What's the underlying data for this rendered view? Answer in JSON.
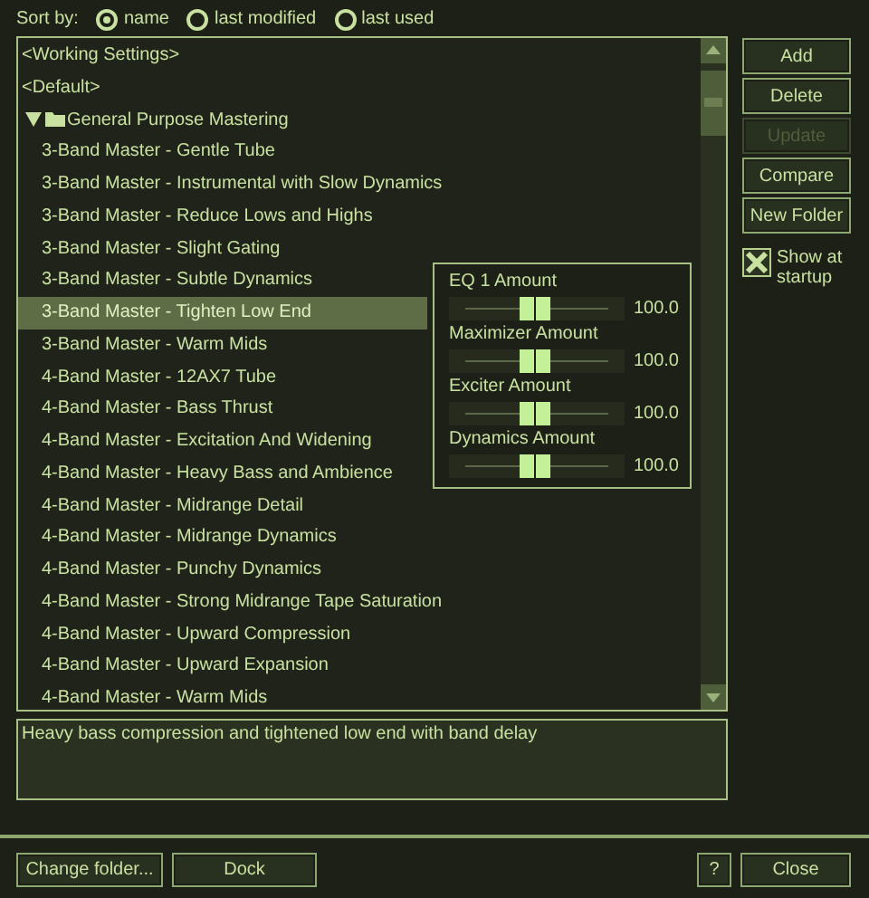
{
  "sort": {
    "label": "Sort by:",
    "options": [
      {
        "label": "name",
        "selected": true
      },
      {
        "label": "last modified",
        "selected": false
      },
      {
        "label": "last used",
        "selected": false
      }
    ]
  },
  "presets": [
    {
      "kind": "item",
      "label": "<Working Settings>",
      "selected": false
    },
    {
      "kind": "item",
      "label": "<Default>",
      "selected": false
    },
    {
      "kind": "folder",
      "label": "General Purpose Mastering",
      "expanded": true,
      "children": [
        {
          "label": "3-Band Master - Gentle Tube",
          "selected": false
        },
        {
          "label": "3-Band Master - Instrumental with Slow Dynamics",
          "selected": false
        },
        {
          "label": "3-Band Master - Reduce Lows and Highs",
          "selected": false
        },
        {
          "label": "3-Band Master - Slight Gating",
          "selected": false
        },
        {
          "label": "3-Band Master - Subtle Dynamics",
          "selected": false
        },
        {
          "label": "3-Band Master - Tighten Low End",
          "selected": true
        },
        {
          "label": "3-Band Master - Warm Mids",
          "selected": false
        },
        {
          "label": "4-Band Master - 12AX7 Tube",
          "selected": false
        },
        {
          "label": "4-Band Master - Bass Thrust",
          "selected": false
        },
        {
          "label": "4-Band Master - Excitation And Widening",
          "selected": false
        },
        {
          "label": "4-Band Master - Heavy Bass and Ambience",
          "selected": false
        },
        {
          "label": "4-Band Master - Midrange Detail",
          "selected": false
        },
        {
          "label": "4-Band Master - Midrange Dynamics",
          "selected": false
        },
        {
          "label": "4-Band Master - Punchy Dynamics",
          "selected": false
        },
        {
          "label": "4-Band Master - Strong Midrange Tape Saturation",
          "selected": false
        },
        {
          "label": "4-Band Master - Upward Compression",
          "selected": false
        },
        {
          "label": "4-Band Master - Upward Expansion",
          "selected": false
        },
        {
          "label": "4-Band Master - Warm Mids",
          "selected": false
        }
      ]
    }
  ],
  "amounts": [
    {
      "label": "EQ 1 Amount",
      "level": 0.5,
      "reading": "100.0"
    },
    {
      "label": "Maximizer Amount",
      "level": 0.5,
      "reading": "100.0"
    },
    {
      "label": "Exciter Amount",
      "level": 0.5,
      "reading": "100.0"
    },
    {
      "label": "Dynamics Amount",
      "level": 0.5,
      "reading": "100.0"
    }
  ],
  "side_buttons": [
    {
      "label": "Add",
      "disabled": false
    },
    {
      "label": "Delete",
      "disabled": false
    },
    {
      "label": "Update",
      "disabled": true
    },
    {
      "label": "Compare",
      "disabled": false
    },
    {
      "label": "New Folder",
      "disabled": false
    }
  ],
  "show_at_startup": {
    "label": "Show at startup",
    "checked": true
  },
  "description": "Heavy bass compression and tightened low end with band delay",
  "bottom_left": [
    {
      "label": "Change folder..."
    },
    {
      "label": "Dock"
    }
  ],
  "bottom_right": [
    {
      "label": "?"
    },
    {
      "label": "Close"
    }
  ]
}
